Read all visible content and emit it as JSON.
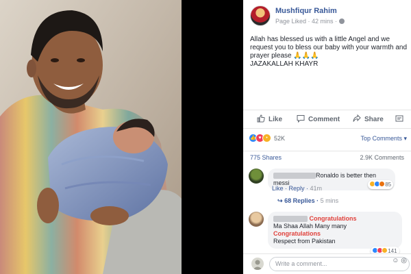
{
  "post": {
    "author": "Mushfiqur Rahim",
    "meta": "Page Liked · 42 mins · ",
    "text_line1": "Allah has blessed us with a little Angel and we",
    "text_line2": "request you to bless our baby with your warmth and",
    "text_line3": "prayer please 🙏🙏🙏",
    "text_line4": "JAZAKALLAH KHAYR"
  },
  "actions": {
    "like": "Like",
    "comment": "Comment",
    "share": "Share"
  },
  "stats": {
    "reactions": "52K",
    "top_comments": "Top Comments ▾",
    "shares": "775 Shares",
    "comments": "2.9K Comments"
  },
  "comments": [
    {
      "text": "Ronaldo is better then messi",
      "like": "Like",
      "reply": "Reply",
      "time": "41m",
      "reaction_count": "85",
      "replies": "68 Replies",
      "replies_time": "5 mins"
    },
    {
      "highlight1": "Congratulations",
      "line2": "Ma Shaa Allah Many many",
      "highlight2": "Congratulations",
      "line4": "Respect from Pakistan",
      "reaction_count": "141"
    }
  ],
  "write_comment": {
    "placeholder": "Write a comment..."
  },
  "colors": {
    "link": "#385898",
    "like_blue": "#2d88ff",
    "love_red": "#f33e58",
    "highlight": "#e0413b"
  }
}
